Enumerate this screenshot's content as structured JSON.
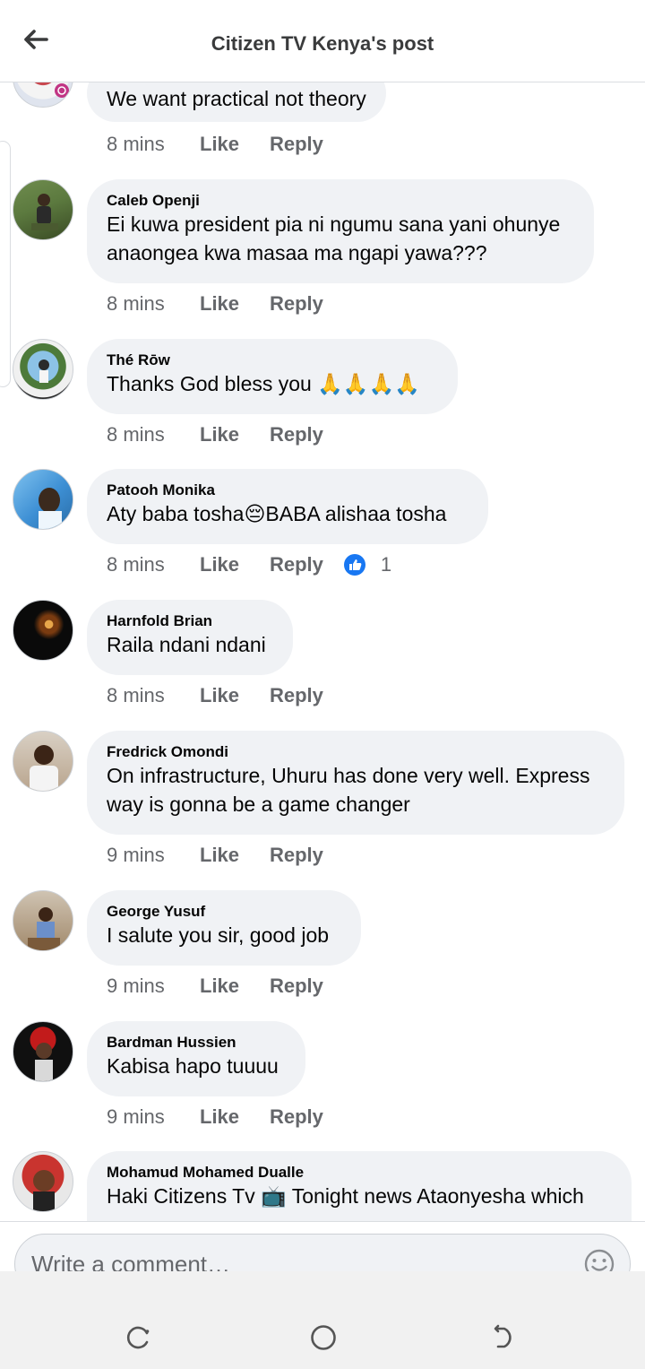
{
  "header": {
    "title": "Citizen TV Kenya's post"
  },
  "comments": [
    {
      "author": "",
      "text": "We want practical not theory",
      "time": "8 mins",
      "like": "Like",
      "reply": "Reply",
      "reactions": ""
    },
    {
      "author": "Caleb Openji",
      "text": "Ei kuwa president pia ni ngumu sana yani ohunye anaongea kwa masaa ma ngapi yawa???",
      "time": "8 mins",
      "like": "Like",
      "reply": "Reply",
      "reactions": ""
    },
    {
      "author": "Thé Rōw",
      "text": "Thanks God bless you 🙏🙏🙏🙏",
      "time": "8 mins",
      "like": "Like",
      "reply": "Reply",
      "reactions": ""
    },
    {
      "author": "Patooh Monika",
      "text": "Aty baba tosha😔BABA alishaa tosha",
      "time": "8 mins",
      "like": "Like",
      "reply": "Reply",
      "reactions": "1"
    },
    {
      "author": "Harnfold Brian",
      "text": "Raila ndani ndani",
      "time": "8 mins",
      "like": "Like",
      "reply": "Reply",
      "reactions": ""
    },
    {
      "author": "Fredrick Omondi",
      "text": "On infrastructure, Uhuru has done very well. Express way is gonna be a game changer",
      "time": "9 mins",
      "like": "Like",
      "reply": "Reply",
      "reactions": ""
    },
    {
      "author": "George Yusuf",
      "text": "I salute you sir, good job",
      "time": "9 mins",
      "like": "Like",
      "reply": "Reply",
      "reactions": ""
    },
    {
      "author": "Bardman Hussien",
      "text": "Kabisa hapo tuuuu",
      "time": "9 mins",
      "like": "Like",
      "reply": "Reply",
      "reactions": ""
    },
    {
      "author": "Mohamud Mohamed Dualle",
      "text": "Haki Citizens Tv 📺 Tonight news Ataonyesha which",
      "time": "",
      "like": "",
      "reply": "",
      "reactions": ""
    }
  ],
  "composer": {
    "placeholder": "Write a comment…",
    "emoji_icon": "smiley-icon"
  },
  "navbar": {
    "icons": [
      "recent-apps-icon",
      "home-icon",
      "back-icon"
    ]
  },
  "colors": {
    "bubble": "#f0f2f5",
    "meta": "#65676b",
    "like_reaction": "#1877f2"
  }
}
